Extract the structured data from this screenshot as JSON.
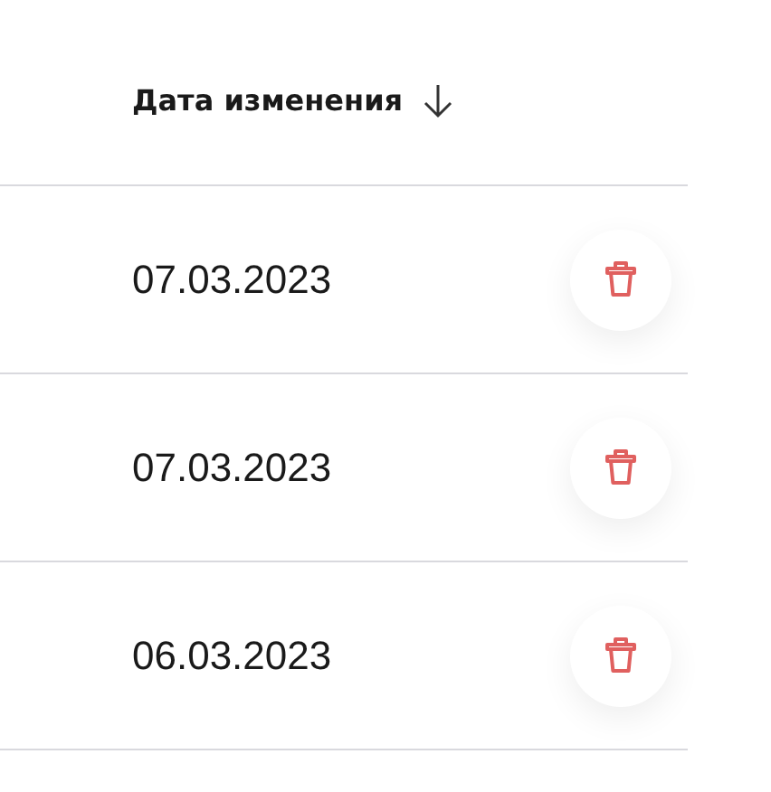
{
  "column_header": {
    "label": "Дата изменения",
    "sort_descending": true
  },
  "rows": [
    {
      "date": "07.03.2023"
    },
    {
      "date": "07.03.2023"
    },
    {
      "date": "06.03.2023"
    }
  ]
}
